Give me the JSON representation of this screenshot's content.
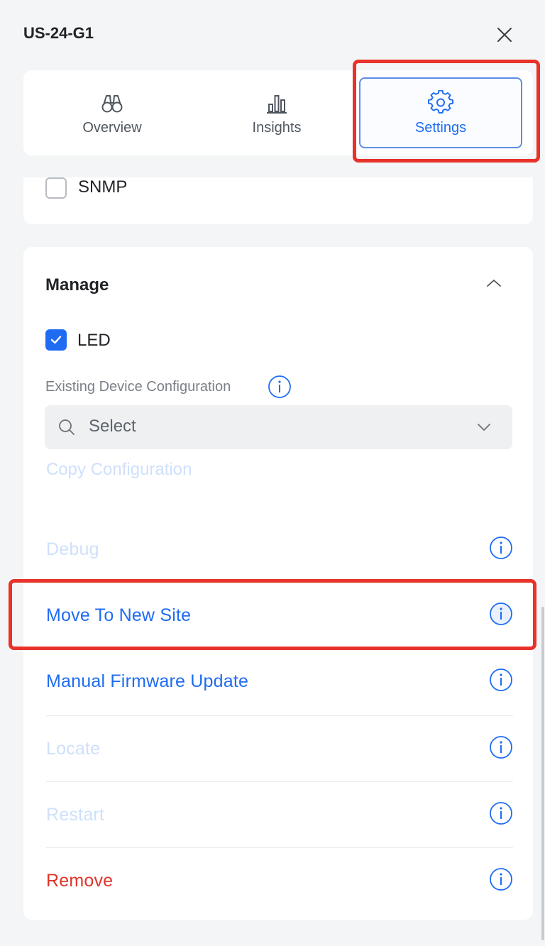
{
  "header": {
    "title": "US-24-G1"
  },
  "tabs": [
    {
      "label": "Overview",
      "icon": "binoculars-icon"
    },
    {
      "label": "Insights",
      "icon": "bar-chart-icon"
    },
    {
      "label": "Settings",
      "icon": "gear-icon",
      "active": true
    }
  ],
  "snmp": {
    "label": "SNMP",
    "checked": false
  },
  "manage": {
    "title": "Manage",
    "led": {
      "label": "LED",
      "checked": true
    },
    "existing_config": {
      "label": "Existing Device Configuration",
      "select_placeholder": "Select"
    },
    "copy_label": "Copy Configuration",
    "actions": [
      {
        "label": "Debug",
        "state": "disabled"
      },
      {
        "label": "Move To New Site",
        "state": "enabled"
      },
      {
        "label": "Manual Firmware Update",
        "state": "enabled"
      },
      {
        "label": "Locate",
        "state": "disabled"
      },
      {
        "label": "Restart",
        "state": "disabled"
      },
      {
        "label": "Remove",
        "state": "danger"
      }
    ]
  },
  "colors": {
    "accent": "#1f6cf2",
    "disabled": "#cfe0fb",
    "danger": "#e0352b",
    "highlight": "#e8322a"
  }
}
